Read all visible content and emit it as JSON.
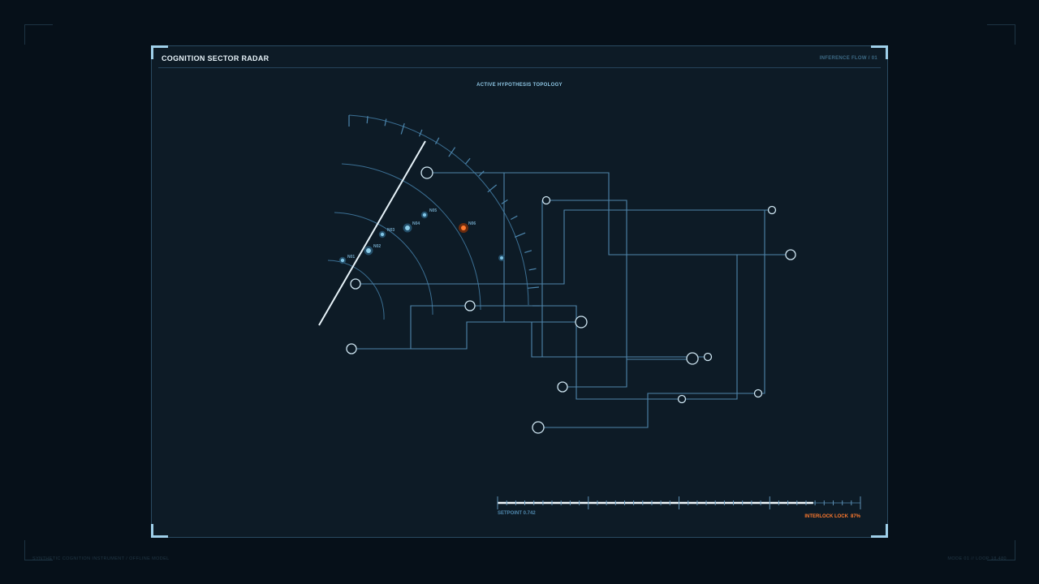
{
  "panel": {
    "title": "COGNITION SECTOR RADAR",
    "tag": "INFERENCE FLOW / 01",
    "chart_title": "ACTIVE HYPOTHESIS TOPOLOGY"
  },
  "radar": {
    "nodes": [
      {
        "label": "N01",
        "state": "normal"
      },
      {
        "label": "N02",
        "state": "normal"
      },
      {
        "label": "N03",
        "state": "normal"
      },
      {
        "label": "N04",
        "state": "normal"
      },
      {
        "label": "N05",
        "state": "normal"
      },
      {
        "label": "N06",
        "state": "alert"
      }
    ]
  },
  "gauge": {
    "setpoint_label": "SETPOINT 0.742",
    "interlock_label": "INTERLOCK LOCK",
    "interlock_value": "87%",
    "fill_fraction": 0.87
  },
  "footer": {
    "left": "SYNTHETIC COGNITION INSTRUMENT / OFFLINE MODEL",
    "right": "MODE 01 // LOOP 18.480"
  },
  "colors": {
    "background": "#061019",
    "panel": "#0d1b26",
    "line": "#5d8fb3",
    "node_fill": "#7fc3e3",
    "alert": "#ff7a2e",
    "frame": "#9fd0ea"
  }
}
